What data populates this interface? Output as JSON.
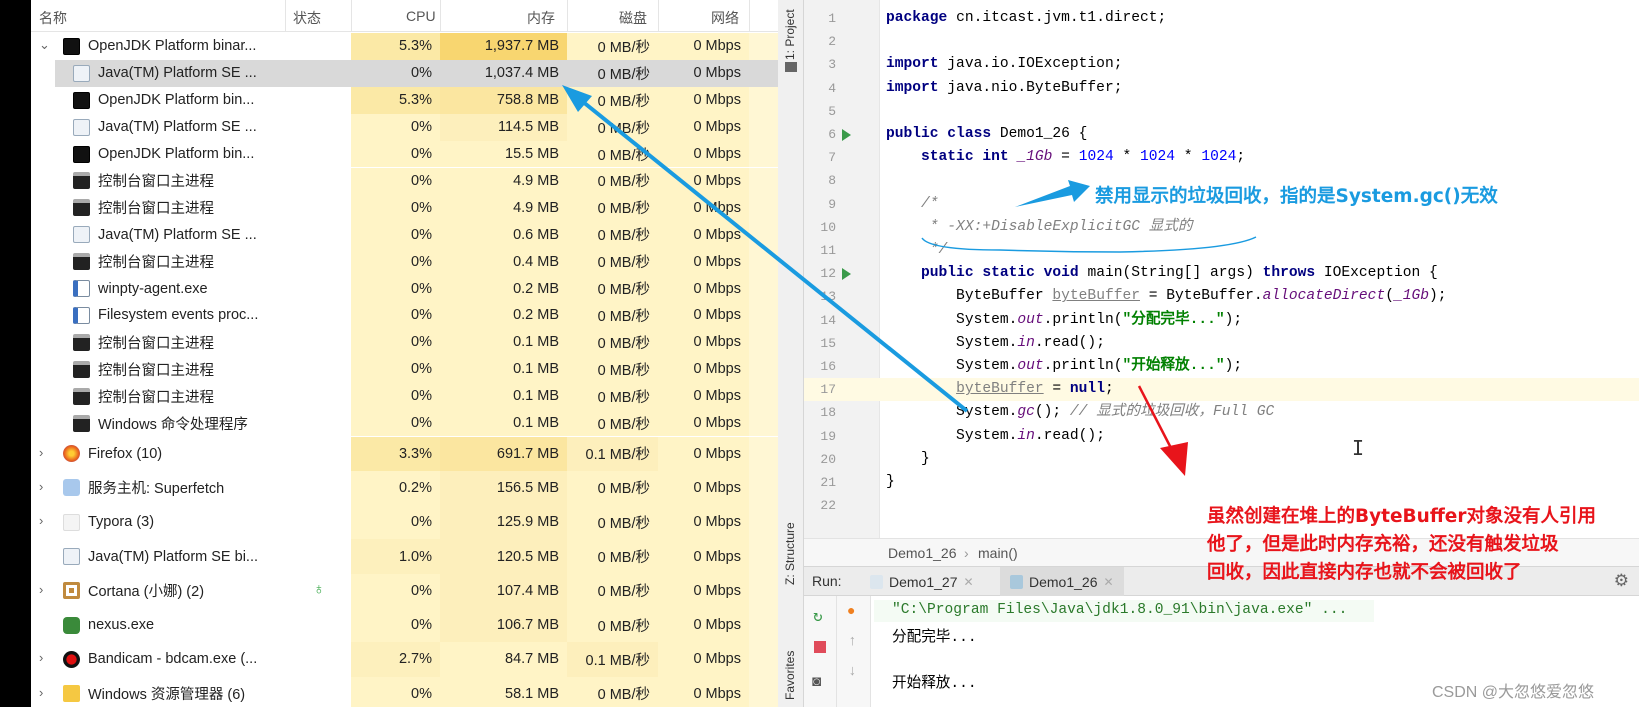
{
  "task_manager": {
    "headers": {
      "name": "名称",
      "status": "状态",
      "cpu": "CPU",
      "memory": "内存",
      "disk": "磁盘",
      "network": "网络"
    },
    "rows": [
      {
        "name": "OpenJDK Platform binar...",
        "cpu": "5.3%",
        "memory": "1,937.7 MB",
        "disk": "0 MB/秒",
        "network": "0 Mbps",
        "icon": "jetbrains-icon",
        "level": "parent",
        "expanded": true
      },
      {
        "name": "Java(TM) Platform SE ...",
        "cpu": "0%",
        "memory": "1,037.4 MB",
        "disk": "0 MB/秒",
        "network": "0 Mbps",
        "icon": "java-icon",
        "level": "child",
        "selected": true
      },
      {
        "name": "OpenJDK Platform bin...",
        "cpu": "5.3%",
        "memory": "758.8 MB",
        "disk": "0 MB/秒",
        "network": "0 Mbps",
        "icon": "jetbrains-icon",
        "level": "child"
      },
      {
        "name": "Java(TM) Platform SE ...",
        "cpu": "0%",
        "memory": "114.5 MB",
        "disk": "0 MB/秒",
        "network": "0 Mbps",
        "icon": "java-icon",
        "level": "child"
      },
      {
        "name": "OpenJDK Platform bin...",
        "cpu": "0%",
        "memory": "15.5 MB",
        "disk": "0 MB/秒",
        "network": "0 Mbps",
        "icon": "jetbrains-icon",
        "level": "child"
      },
      {
        "name": "控制台窗口主进程",
        "cpu": "0%",
        "memory": "4.9 MB",
        "disk": "0 MB/秒",
        "network": "0 Mbps",
        "icon": "console-icon",
        "level": "child"
      },
      {
        "name": "控制台窗口主进程",
        "cpu": "0%",
        "memory": "4.9 MB",
        "disk": "0 MB/秒",
        "network": "0 Mbps",
        "icon": "console-icon",
        "level": "child"
      },
      {
        "name": "Java(TM) Platform SE ...",
        "cpu": "0%",
        "memory": "0.6 MB",
        "disk": "0 MB/秒",
        "network": "0 Mbps",
        "icon": "java-icon",
        "level": "child"
      },
      {
        "name": "控制台窗口主进程",
        "cpu": "0%",
        "memory": "0.4 MB",
        "disk": "0 MB/秒",
        "network": "0 Mbps",
        "icon": "console-icon",
        "level": "child"
      },
      {
        "name": "winpty-agent.exe",
        "cpu": "0%",
        "memory": "0.2 MB",
        "disk": "0 MB/秒",
        "network": "0 Mbps",
        "icon": "window-icon",
        "level": "child"
      },
      {
        "name": "Filesystem events proc...",
        "cpu": "0%",
        "memory": "0.2 MB",
        "disk": "0 MB/秒",
        "network": "0 Mbps",
        "icon": "window-icon",
        "level": "child"
      },
      {
        "name": "控制台窗口主进程",
        "cpu": "0%",
        "memory": "0.1 MB",
        "disk": "0 MB/秒",
        "network": "0 Mbps",
        "icon": "console-icon",
        "level": "child"
      },
      {
        "name": "控制台窗口主进程",
        "cpu": "0%",
        "memory": "0.1 MB",
        "disk": "0 MB/秒",
        "network": "0 Mbps",
        "icon": "console-icon",
        "level": "child"
      },
      {
        "name": "控制台窗口主进程",
        "cpu": "0%",
        "memory": "0.1 MB",
        "disk": "0 MB/秒",
        "network": "0 Mbps",
        "icon": "console-icon",
        "level": "child"
      },
      {
        "name": "Windows 命令处理程序",
        "cpu": "0%",
        "memory": "0.1 MB",
        "disk": "0 MB/秒",
        "network": "0 Mbps",
        "icon": "console-icon",
        "level": "child"
      },
      {
        "name": "Firefox (10)",
        "cpu": "3.3%",
        "memory": "691.7 MB",
        "disk": "0.1 MB/秒",
        "network": "0 Mbps",
        "icon": "firefox-icon",
        "level": "group",
        "expandable": true
      },
      {
        "name": "服务主机: Superfetch",
        "cpu": "0.2%",
        "memory": "156.5 MB",
        "disk": "0 MB/秒",
        "network": "0 Mbps",
        "icon": "gear-icon",
        "level": "group",
        "expandable": true
      },
      {
        "name": "Typora (3)",
        "cpu": "0%",
        "memory": "125.9 MB",
        "disk": "0 MB/秒",
        "network": "0 Mbps",
        "icon": "typora-icon",
        "level": "group",
        "expandable": true
      },
      {
        "name": "Java(TM) Platform SE bi...",
        "cpu": "1.0%",
        "memory": "120.5 MB",
        "disk": "0 MB/秒",
        "network": "0 Mbps",
        "icon": "java-icon",
        "level": "group",
        "expandable": false
      },
      {
        "name": "Cortana (小娜) (2)",
        "cpu": "0%",
        "memory": "107.4 MB",
        "disk": "0 MB/秒",
        "network": "0 Mbps",
        "icon": "cortana-icon",
        "level": "group",
        "expandable": true,
        "status_icon": "leaf-icon"
      },
      {
        "name": "nexus.exe",
        "cpu": "0%",
        "memory": "106.7 MB",
        "disk": "0 MB/秒",
        "network": "0 Mbps",
        "icon": "nexus-icon",
        "level": "group",
        "expandable": false
      },
      {
        "name": "Bandicam - bdcam.exe (...",
        "cpu": "2.7%",
        "memory": "84.7 MB",
        "disk": "0.1 MB/秒",
        "network": "0 Mbps",
        "icon": "bandicam-icon",
        "level": "group",
        "expandable": true
      },
      {
        "name": "Windows 资源管理器 (6)",
        "cpu": "0%",
        "memory": "58.1 MB",
        "disk": "0 MB/秒",
        "network": "0 Mbps",
        "icon": "folder-icon",
        "level": "group",
        "expandable": true
      }
    ]
  },
  "ide": {
    "tool_strip": {
      "project": "1: Project",
      "structure": "Z: Structure",
      "favorites": "Favorites"
    },
    "code_lines": [
      [
        [
          "package",
          "kw"
        ],
        [
          " cn.itcast.jvm.t1.direct;",
          ""
        ]
      ],
      [],
      [
        [
          "import",
          "kw"
        ],
        [
          " java.io.IOException;",
          ""
        ]
      ],
      [
        [
          "import",
          "kw"
        ],
        [
          " java.nio.ByteBuffer;",
          ""
        ]
      ],
      [],
      [
        [
          "public class",
          "kw"
        ],
        [
          " Demo1_26 {",
          ""
        ]
      ],
      [
        [
          "    static int ",
          "kw"
        ],
        [
          "_1Gb",
          "st"
        ],
        [
          " = ",
          ""
        ],
        [
          "1024",
          "num"
        ],
        [
          " * ",
          ""
        ],
        [
          "1024",
          "num"
        ],
        [
          " * ",
          ""
        ],
        [
          "1024",
          "num"
        ],
        [
          ";",
          ""
        ]
      ],
      [],
      [
        [
          "    /*",
          "cmt"
        ]
      ],
      [
        [
          "     * -XX:+DisableExplicitGC 显式的",
          "cmt"
        ]
      ],
      [
        [
          "     */",
          "cmt"
        ]
      ],
      [
        [
          "    public static void ",
          "kw"
        ],
        [
          "main(String[] args) ",
          ""
        ],
        [
          "throws",
          "kw"
        ],
        [
          " IOException {",
          ""
        ]
      ],
      [
        [
          "        ByteBuffer ",
          ""
        ],
        [
          "byteBuffer",
          "unused"
        ],
        [
          " = ByteBuffer.",
          ""
        ],
        [
          "allocateDirect",
          "st"
        ],
        [
          "(",
          ""
        ],
        [
          "_1Gb",
          "st"
        ],
        [
          ");",
          ""
        ]
      ],
      [
        [
          "        System.",
          ""
        ],
        [
          "out",
          "st"
        ],
        [
          ".println(",
          ""
        ],
        [
          "\"分配完毕...\"",
          "str"
        ],
        [
          ");",
          ""
        ]
      ],
      [
        [
          "        System.",
          ""
        ],
        [
          "in",
          "st"
        ],
        [
          ".read();",
          ""
        ]
      ],
      [
        [
          "        System.",
          ""
        ],
        [
          "out",
          "st"
        ],
        [
          ".println(",
          ""
        ],
        [
          "\"开始释放...\"",
          "str"
        ],
        [
          ");",
          ""
        ]
      ],
      [
        [
          "        ",
          ""
        ],
        [
          "byteBuffer",
          "unused"
        ],
        [
          " = ",
          ""
        ],
        [
          "null",
          "kw"
        ],
        [
          ";",
          ""
        ]
      ],
      [
        [
          "        System.",
          ""
        ],
        [
          "gc",
          "st"
        ],
        [
          "(); ",
          ""
        ],
        [
          "// 显式的垃圾回收，Full GC",
          "cmt"
        ]
      ],
      [
        [
          "        System.",
          ""
        ],
        [
          "in",
          "st"
        ],
        [
          ".read();",
          ""
        ]
      ],
      [
        [
          "    }",
          ""
        ]
      ],
      [
        [
          "}",
          ""
        ]
      ],
      []
    ],
    "run_gutter_lines": [
      6,
      12
    ],
    "current_line": 17,
    "breadcrumb": [
      "Demo1_26",
      "main()"
    ],
    "run": {
      "label": "Run:",
      "tabs": [
        {
          "label": "Demo1_27",
          "active": false
        },
        {
          "label": "Demo1_26",
          "active": true
        }
      ],
      "console": [
        "\"C:\\Program Files\\Java\\jdk1.8.0_91\\bin\\java.exe\" ...",
        "分配完毕...",
        "",
        "开始释放..."
      ]
    }
  },
  "annotations": {
    "blue_note": "禁用显示的垃圾回收，指的是System.gc()无效",
    "red_note": [
      "虽然创建在堆上的ByteBuffer对象没有人引用",
      "他了，但是此时内存充裕，还没有触发垃圾",
      "回收，因此直接内存也就不会被回收了"
    ],
    "blue_color": "#1a9be0",
    "red_color": "#e8141b"
  },
  "watermark": "CSDN @大忽悠爱忽悠"
}
